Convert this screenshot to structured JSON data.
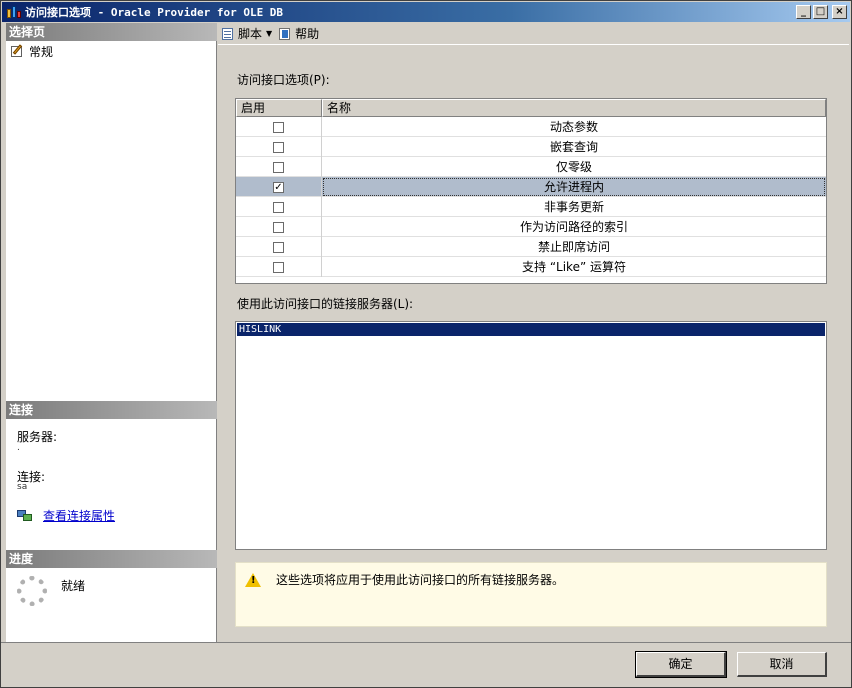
{
  "window": {
    "title": "访问接口选项 - Oracle Provider for OLE DB",
    "controls": {
      "minimize": "_",
      "maximize": "□",
      "close": "×"
    }
  },
  "left_pane": {
    "select_page_header": "选择页",
    "nav_items": [
      {
        "label": "常规",
        "icon": "general-page-icon"
      }
    ],
    "connection_header": "连接",
    "server_label": "服务器:",
    "server_value": ".",
    "connection_label": "连接:",
    "connection_value": "sa",
    "view_connection_properties": "查看连接属性",
    "progress_header": "进度",
    "progress_status": "就绪"
  },
  "toolbar": {
    "script_label": "脚本",
    "help_label": "帮助"
  },
  "options": {
    "label": "访问接口选项(P):",
    "columns": [
      "启用",
      "名称"
    ],
    "rows": [
      {
        "name": "动态参数",
        "enabled": false
      },
      {
        "name": "嵌套查询",
        "enabled": false
      },
      {
        "name": "仅零级",
        "enabled": false
      },
      {
        "name": "允许进程内",
        "enabled": true
      },
      {
        "name": "非事务更新",
        "enabled": false
      },
      {
        "name": "作为访问路径的索引",
        "enabled": false
      },
      {
        "name": "禁止即席访问",
        "enabled": false
      },
      {
        "name": "支持 “Like” 运算符",
        "enabled": false
      }
    ],
    "selected_row": 3
  },
  "linked_servers": {
    "label": "使用此访问接口的链接服务器(L):",
    "items": [
      "HISLINK"
    ]
  },
  "info_message": "这些选项将应用于使用此访问接口的所有链接服务器。",
  "buttons": {
    "ok": "确定",
    "cancel": "取消"
  },
  "colors": {
    "title_bar": "#0a246a",
    "selected_row": "#b0bccc",
    "selection_highlight": "#0a246a",
    "info_background": "#fffbe6"
  }
}
